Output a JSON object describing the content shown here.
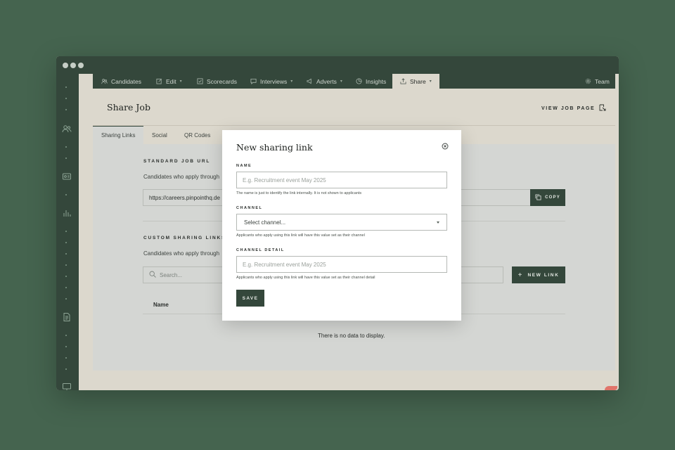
{
  "colors": {
    "background": "#45644f",
    "dark_green": "#34473b",
    "panel": "#dcd8cd",
    "content": "#d4d6d3",
    "accent_corner": "#e0746a"
  },
  "nav": {
    "tabs": [
      {
        "label": "Candidates",
        "icon": "people-icon",
        "dropdown": false
      },
      {
        "label": "Edit",
        "icon": "edit-icon",
        "dropdown": true
      },
      {
        "label": "Scorecards",
        "icon": "checkbox-icon",
        "dropdown": false
      },
      {
        "label": "Interviews",
        "icon": "chat-icon",
        "dropdown": true
      },
      {
        "label": "Adverts",
        "icon": "megaphone-icon",
        "dropdown": true
      },
      {
        "label": "Insights",
        "icon": "pie-chart-icon",
        "dropdown": false
      },
      {
        "label": "Share",
        "icon": "share-icon",
        "dropdown": true,
        "active": true
      }
    ],
    "team_label": "Team"
  },
  "page": {
    "title": "Share Job",
    "view_job_label": "VIEW JOB PAGE"
  },
  "subtabs": [
    "Sharing Links",
    "Social",
    "QR Codes"
  ],
  "standard": {
    "title": "STANDARD JOB URL",
    "description": "Candidates who apply through",
    "url": "https://careers.pinpointhq.de",
    "copy_label": "COPY"
  },
  "custom": {
    "title": "CUSTOM SHARING LINKS",
    "description": "Candidates who apply through",
    "search_placeholder": "Search...",
    "new_link_label": "NEW LINK",
    "column_name": "Name",
    "empty_text": "There is no data to display."
  },
  "modal": {
    "title": "New sharing link",
    "name_label": "NAME",
    "name_placeholder": "E.g. Recruitment event May 2025",
    "name_help": "The name is just to identify the link internally. It is not shown to applicants",
    "channel_label": "CHANNEL",
    "channel_value": "Select channel...",
    "channel_help": "Applicants who apply using this link will have this value set as their channel",
    "channel_detail_label": "CHANNEL DETAIL",
    "channel_detail_placeholder": "E.g. Recruitment event May 2025",
    "channel_detail_help": "Applicants who apply using this link will have this value set as their channel detail",
    "save_label": "SAVE"
  }
}
